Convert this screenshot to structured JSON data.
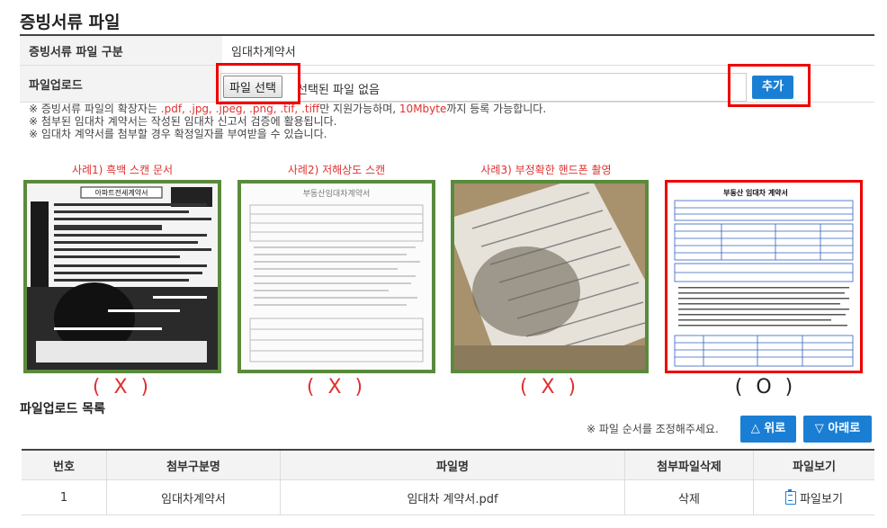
{
  "section_title": "증빙서류 파일",
  "form": {
    "category_label": "증빙서류 파일 구분",
    "category_value": "임대차계약서",
    "upload_label": "파일업로드",
    "file_button_label": "파일 선택",
    "file_status": "선택된 파일 없음",
    "add_button_label": "추가"
  },
  "notes": {
    "line1_a": "※ 증빙서류 파일의 확장자는 ",
    "line1_ext": ".pdf, .jpg, .jpeg, .png, .tif, .tiff",
    "line1_b": "만 지원가능하며, ",
    "line1_size": "10Mbyte",
    "line1_c": "까지 등록 가능합니다.",
    "line2": "※ 첨부된 임대차 계약서는 작성된 임대차 신고서 검증에 활용됩니다.",
    "line3": "※ 임대차 계약서를 첨부할 경우 확정일자를 부여받을 수 있습니다."
  },
  "examples": [
    {
      "label": "사례1) 흑백 스캔 문서",
      "mark": "( X )",
      "valid": false
    },
    {
      "label": "사례2) 저해상도 스캔",
      "mark": "( X )",
      "valid": false
    },
    {
      "label": "사례3) 부정확한 핸드폰 촬영",
      "mark": "( X )",
      "valid": false
    },
    {
      "label": "",
      "mark": "( O )",
      "valid": true
    }
  ],
  "example_doc_texts": {
    "ex1_title": "아파트전세계약서",
    "ex2_title": "부동산임대차계약서",
    "ex4_title": "부동산 임대차 계약서"
  },
  "upload_list": {
    "title": "파일업로드 목록",
    "order_note": "※ 파일 순서를 조정해주세요.",
    "up_button": "△ 위로",
    "down_button": "▽ 아래로",
    "columns": [
      "번호",
      "첨부구분명",
      "파일명",
      "첨부파일삭제",
      "파일보기"
    ],
    "rows": [
      {
        "no": "1",
        "category": "임대차계약서",
        "filename": "임대차 계약서.pdf",
        "delete": "삭제",
        "view": "파일보기"
      }
    ]
  },
  "colors": {
    "accent": "#1a7fd4",
    "warning": "#e03030",
    "highlight_border": "#ee0000",
    "example_border": "#5a8a3c"
  }
}
